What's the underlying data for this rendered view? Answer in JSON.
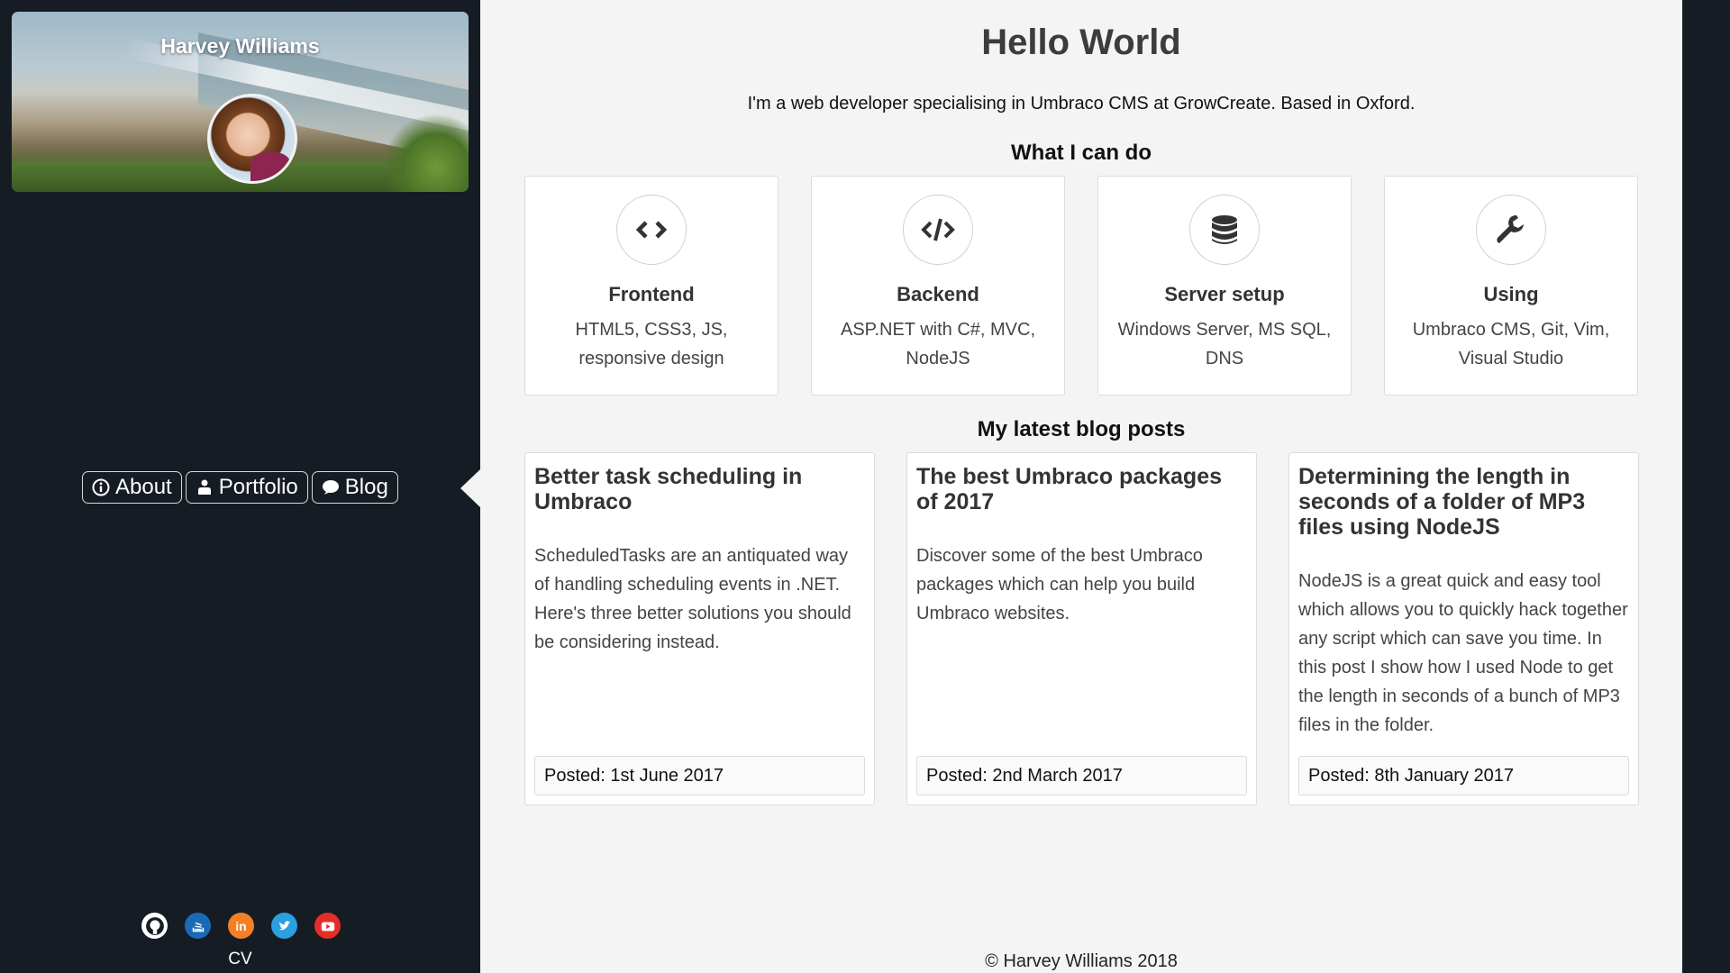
{
  "sidebar": {
    "profile_name": "Harvey Williams",
    "nav": [
      {
        "label": "About",
        "icon": "info-circle-icon"
      },
      {
        "label": "Portfolio",
        "icon": "user-icon"
      },
      {
        "label": "Blog",
        "icon": "comment-icon"
      }
    ],
    "social": [
      {
        "name": "github-icon",
        "color": "#161c23"
      },
      {
        "name": "stackoverflow-icon",
        "color": "#1b6ab5"
      },
      {
        "name": "linkedin-icon",
        "color": "#f47f24"
      },
      {
        "name": "twitter-icon",
        "color": "#2c9fe0"
      },
      {
        "name": "youtube-icon",
        "color": "#e52d27"
      }
    ],
    "cv_label": "CV"
  },
  "main": {
    "title": "Hello World",
    "intro": "I'm a web developer specialising in Umbraco CMS at GrowCreate. Based in Oxford.",
    "skills_heading": "What I can do",
    "skills": [
      {
        "icon": "code-icon",
        "title": "Frontend",
        "desc_line1": "HTML5, CSS3, JS,",
        "desc_line2": "responsive design"
      },
      {
        "icon": "code-slash-icon",
        "title": "Backend",
        "desc_line1": "ASP.NET with C#, MVC,",
        "desc_line2": "NodeJS"
      },
      {
        "icon": "database-icon",
        "title": "Server setup",
        "desc_line1": "Windows Server, MS SQL,",
        "desc_line2": "DNS"
      },
      {
        "icon": "wrench-icon",
        "title": "Using",
        "desc_line1": "Umbraco CMS, Git, Vim,",
        "desc_line2": "Visual Studio"
      }
    ],
    "blog_heading": "My latest blog posts",
    "posts": [
      {
        "title": "Better task scheduling in Umbraco",
        "excerpt": "ScheduledTasks are an antiquated way of handling scheduling events in .NET. Here's three better solutions you should be considering instead.",
        "date": "Posted: 1st June 2017"
      },
      {
        "title": "The best Umbraco packages of 2017",
        "excerpt": "Discover some of the best Umbraco packages which can help you build Umbraco websites.",
        "date": "Posted: 2nd March 2017"
      },
      {
        "title": "Determining the length in seconds of a folder of MP3 files using NodeJS",
        "excerpt": "NodeJS is a great quick and easy tool which allows you to quickly hack together any script which can save you time. In this post I show how I used Node to get the length in seconds of a bunch of MP3 files in the folder.",
        "date": "Posted: 8th January 2017"
      }
    ],
    "footer": "© Harvey Williams 2018"
  }
}
